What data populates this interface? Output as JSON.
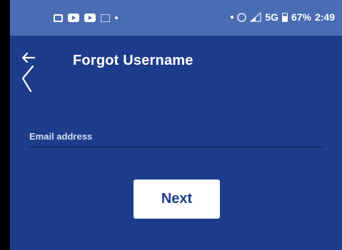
{
  "colors": {
    "screen_background": "#1e3c8c",
    "status_bar": "#4a6cb3",
    "button_background": "#ffffff",
    "button_text": "#1e3c8c",
    "text": "#ffffff"
  },
  "status_bar": {
    "left_icons": [
      "message-icon",
      "youtube-icon",
      "youtube-icon",
      "gmail-icon",
      "notification-dot"
    ],
    "right_icons": [
      "notification-dot",
      "data-saver-icon",
      "signal-icon",
      "battery-icon"
    ],
    "network": "5G",
    "battery": "67%",
    "time": "2:49"
  },
  "header": {
    "back_icon": "back-arrow-icon",
    "title": "Forgot Username"
  },
  "form": {
    "email_label": "Email address",
    "email_value": "",
    "next_label": "Next"
  }
}
